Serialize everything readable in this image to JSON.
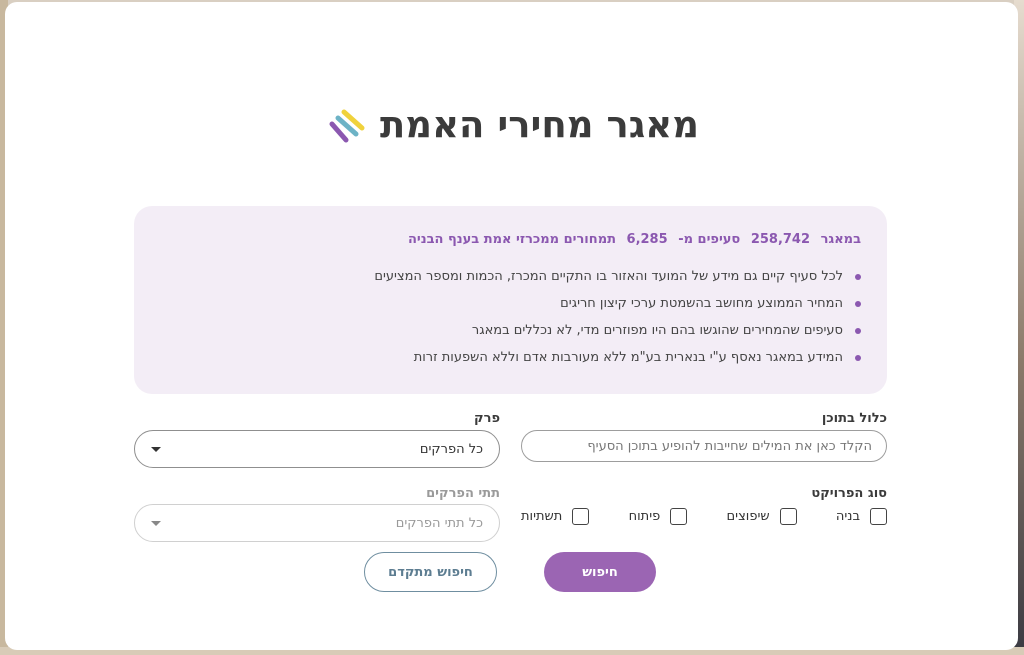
{
  "title": "מאגר מחירי האמת",
  "colors": {
    "accent": "#9b65b3",
    "info_bg": "#f3edf6",
    "logo": [
      "#f0d23c",
      "#6db3c6",
      "#8b58b0"
    ]
  },
  "info": {
    "stats": [
      "במאגר",
      "258,742",
      "סעיפים מ-",
      "6,285",
      "תמחורים ממכרזי אמת בענף הבניה"
    ],
    "bullets": [
      "לכל סעיף קיים גם מידע של המועד והאזור בו התקיים המכרז, הכמות ומספר המציעים",
      "המחיר הממוצע מחושב בהשמטת ערכי קיצון חריגים",
      "סעיפים שהמחירים שהוגשו בהם היו מפוזרים מדי, לא נכללים במאגר",
      "המידע במאגר נאסף ע\"י בנארית בע\"מ ללא מעורבות אדם וללא השפעות זרות"
    ]
  },
  "form": {
    "content_label": "כלול בתוכן",
    "content_placeholder": "הקלד כאן את המילים שחייבות להופיע בתוכן הסעיף",
    "chapter_label": "פרק",
    "chapter_value": "כל הפרקים",
    "subchapter_label": "תתי הפרקים",
    "subchapter_value": "כל תתי הפרקים",
    "project_type_label": "סוג הפרויקט",
    "project_types": [
      "בניה",
      "שיפוצים",
      "פיתוח",
      "תשתיות"
    ],
    "search_button": "חיפוש",
    "advanced_button": "חיפוש מתקדם"
  }
}
